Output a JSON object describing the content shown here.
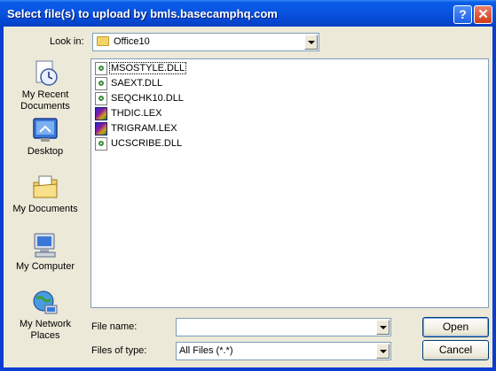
{
  "dialog": {
    "title": "Select file(s) to upload by bmls.basecamphq.com",
    "help_glyph": "?",
    "close_glyph": "✕"
  },
  "toolbar": {
    "look_in_label": "Look in:",
    "look_in_value": "Office10",
    "icons": [
      "back-arrow-icon",
      "up-folder-icon",
      "new-folder-icon",
      "view-menu-icon"
    ]
  },
  "places": [
    {
      "id": "recent",
      "label": "My Recent\nDocuments",
      "icon": "recent-documents-icon"
    },
    {
      "id": "desktop",
      "label": "Desktop",
      "icon": "desktop-icon"
    },
    {
      "id": "mydocs",
      "label": "My Documents",
      "icon": "my-documents-icon"
    },
    {
      "id": "mycomputer",
      "label": "My Computer",
      "icon": "my-computer-icon"
    },
    {
      "id": "network",
      "label": "My Network\nPlaces",
      "icon": "network-places-icon"
    }
  ],
  "files": [
    {
      "name": "MSOSTYLE.DLL",
      "type": "dll"
    },
    {
      "name": "SAEXT.DLL",
      "type": "dll"
    },
    {
      "name": "SEQCHK10.DLL",
      "type": "dll"
    },
    {
      "name": "THDIC.LEX",
      "type": "lex"
    },
    {
      "name": "TRIGRAM.LEX",
      "type": "lex"
    },
    {
      "name": "UCSCRIBE.DLL",
      "type": "dll"
    }
  ],
  "form": {
    "file_name_label": "File name:",
    "file_name_value": "",
    "files_of_type_label": "Files of type:",
    "files_of_type_value": "All Files (*.*)"
  },
  "buttons": {
    "open": "Open",
    "cancel": "Cancel"
  }
}
